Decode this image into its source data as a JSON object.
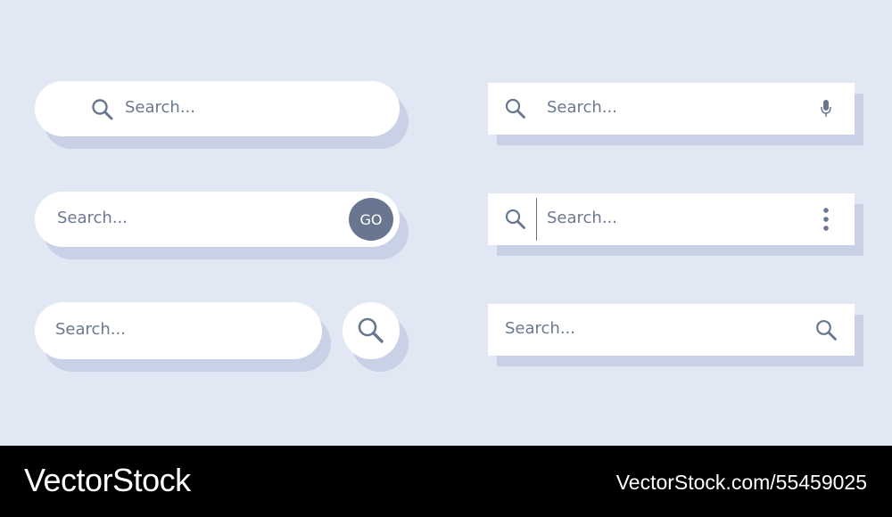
{
  "colors": {
    "background": "#e1e7f3",
    "bar": "#ffffff",
    "shadow": "#c8d1e6",
    "icon": "#68778f",
    "text": "#6b7890",
    "footer": "#000000"
  },
  "search_bars": [
    {
      "variant": "pill-with-leading-search-icon",
      "placeholder": "Search...",
      "icons": [
        "search-icon"
      ]
    },
    {
      "variant": "pill-with-go-button",
      "placeholder": "Search...",
      "button_label": "GO"
    },
    {
      "variant": "pill-with-separate-round-search-button",
      "placeholder": "Search...",
      "icons": [
        "search-icon"
      ]
    },
    {
      "variant": "rect-with-search-and-mic-icons",
      "placeholder": "Search...",
      "icons": [
        "search-icon",
        "microphone-icon"
      ]
    },
    {
      "variant": "rect-with-search-divider-and-menu",
      "placeholder": "Search...",
      "icons": [
        "search-icon",
        "kebab-menu-icon"
      ]
    },
    {
      "variant": "rect-with-trailing-search-icon",
      "placeholder": "Search...",
      "icons": [
        "search-icon"
      ]
    }
  ],
  "footer": {
    "brand": "VectorStock",
    "stock_id": "VectorStock.com/55459025"
  }
}
